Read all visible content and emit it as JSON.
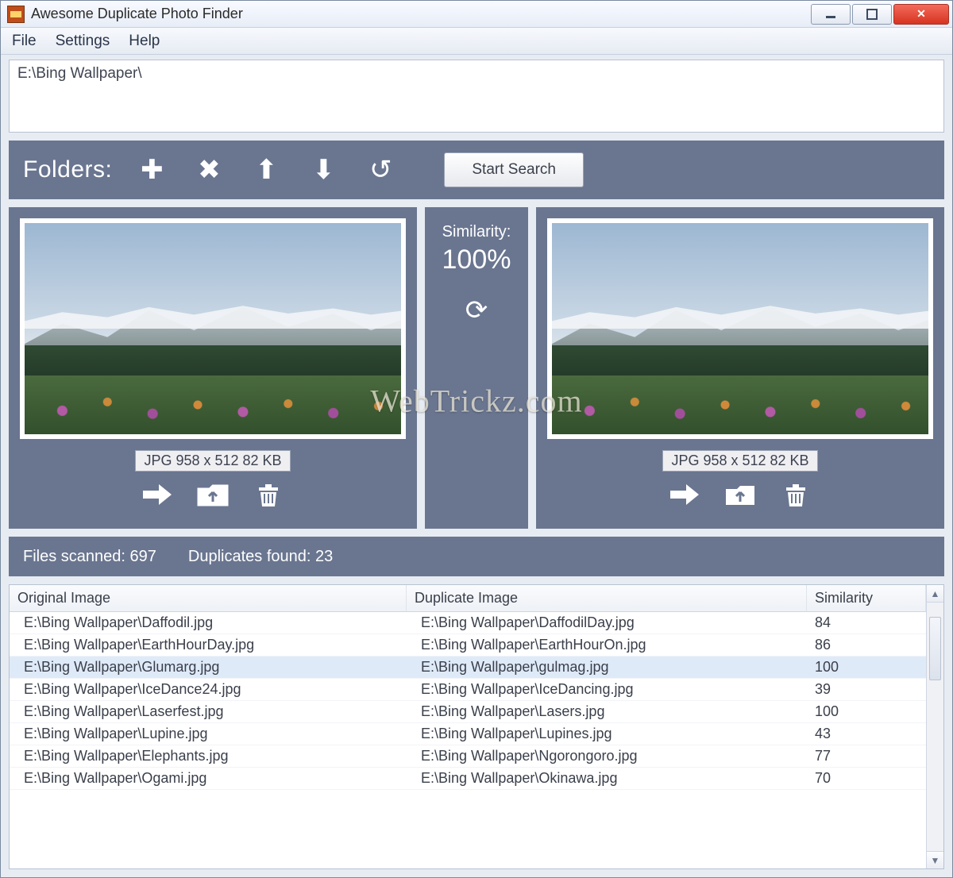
{
  "window": {
    "title": "Awesome Duplicate Photo Finder"
  },
  "menu": {
    "file": "File",
    "settings": "Settings",
    "help": "Help"
  },
  "path": "E:\\Bing Wallpaper\\",
  "toolbar": {
    "label": "Folders:",
    "start_search": "Start Search"
  },
  "similarity": {
    "label": "Similarity:",
    "value": "100%"
  },
  "left": {
    "info": "JPG  958 x 512  82 KB"
  },
  "right": {
    "info": "JPG  958 x 512  82 KB"
  },
  "watermark": "WebTrickz.com",
  "status": {
    "scanned": "Files scanned: 697",
    "dupes": "Duplicates found: 23"
  },
  "table": {
    "headers": {
      "orig": "Original Image",
      "dup": "Duplicate Image",
      "sim": "Similarity"
    },
    "rows": [
      {
        "orig": "E:\\Bing Wallpaper\\Daffodil.jpg",
        "dup": "E:\\Bing Wallpaper\\DaffodilDay.jpg",
        "sim": "84",
        "selected": false
      },
      {
        "orig": "E:\\Bing Wallpaper\\EarthHourDay.jpg",
        "dup": "E:\\Bing Wallpaper\\EarthHourOn.jpg",
        "sim": "86",
        "selected": false
      },
      {
        "orig": "E:\\Bing Wallpaper\\Glumarg.jpg",
        "dup": "E:\\Bing Wallpaper\\gulmag.jpg",
        "sim": "100",
        "selected": true
      },
      {
        "orig": "E:\\Bing Wallpaper\\IceDance24.jpg",
        "dup": "E:\\Bing Wallpaper\\IceDancing.jpg",
        "sim": "39",
        "selected": false
      },
      {
        "orig": "E:\\Bing Wallpaper\\Laserfest.jpg",
        "dup": "E:\\Bing Wallpaper\\Lasers.jpg",
        "sim": "100",
        "selected": false
      },
      {
        "orig": "E:\\Bing Wallpaper\\Lupine.jpg",
        "dup": "E:\\Bing Wallpaper\\Lupines.jpg",
        "sim": "43",
        "selected": false
      },
      {
        "orig": "E:\\Bing Wallpaper\\Elephants.jpg",
        "dup": "E:\\Bing Wallpaper\\Ngorongoro.jpg",
        "sim": "77",
        "selected": false
      },
      {
        "orig": "E:\\Bing Wallpaper\\Ogami.jpg",
        "dup": "E:\\Bing Wallpaper\\Okinawa.jpg",
        "sim": "70",
        "selected": false
      }
    ]
  }
}
